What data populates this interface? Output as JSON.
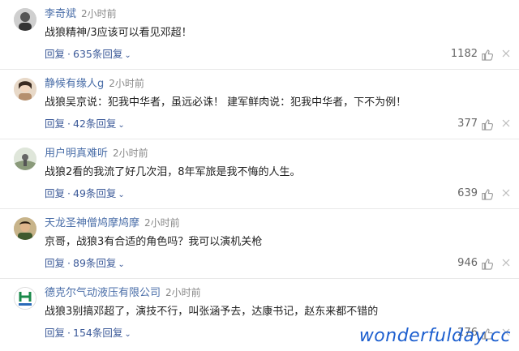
{
  "comments": [
    {
      "name": "李奇斌",
      "time": "2小时前",
      "text": "战狼精神/3应该可以看见邓超！",
      "reply_label": "回复",
      "replies": "635条回复",
      "likes": "1182",
      "avatar": "user-avatar"
    },
    {
      "name": "静候有缘人g",
      "time": "2小时前",
      "text": "战狼吴京说：犯我中华者，虽远必诛！ 建军鲜肉说：犯我中华者，下不为例！",
      "reply_label": "回复",
      "replies": "42条回复",
      "likes": "377",
      "avatar": "user-avatar"
    },
    {
      "name": "用户明真难听",
      "time": "2小时前",
      "text": "战狼2看的我流了好几次泪，8年军旅是我不悔的人生。",
      "reply_label": "回复",
      "replies": "49条回复",
      "likes": "639",
      "avatar": "user-avatar"
    },
    {
      "name": "天龙圣神僧鸠摩鸠摩",
      "time": "2小时前",
      "text": "京哥，战狼3有合适的角色吗？我可以演机关枪",
      "reply_label": "回复",
      "replies": "89条回复",
      "likes": "946",
      "avatar": "user-avatar"
    },
    {
      "name": "德克尔气动液压有限公司",
      "time": "2小时前",
      "text": "战狼3别搞邓超了，演技不行，叫张涵予去，达康书记，赵东来都不错的",
      "reply_label": "回复",
      "replies": "154条回复",
      "likes": "276",
      "avatar": "company-logo"
    }
  ],
  "watermark": "wonderfulday.cc",
  "colors": {
    "name": "#4a6ea8",
    "link": "#3b5998",
    "divider": "#e8e8e8",
    "watermark": "#1d5fcf"
  }
}
